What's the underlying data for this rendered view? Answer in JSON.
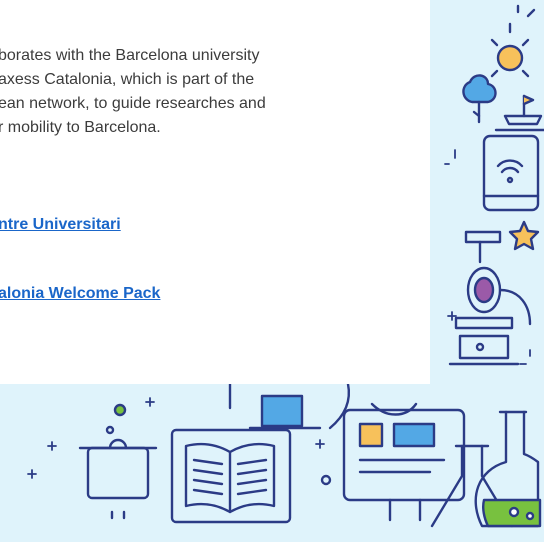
{
  "content": {
    "intro_lines": [
      "borates with the Barcelona university",
      "axess Catalonia, which is part of the",
      "ean network, to guide researches and",
      "r mobility to Barcelona."
    ],
    "links": [
      {
        "label": "ntre Universitari"
      },
      {
        "label": "alonia Welcome Pack"
      }
    ]
  },
  "colors": {
    "panel_background": "#dff3fb",
    "card_background": "#ffffff",
    "body_text": "#3c3c3c",
    "link": "#1a66c9",
    "line_art": "#2b3b86",
    "accent_orange": "#f7c15b",
    "accent_green": "#78c13f",
    "accent_blue": "#53a8e5",
    "accent_purple": "#9b5aa8"
  },
  "illustration": {
    "icons": [
      "sun-icon",
      "tree-icon",
      "boat-icon",
      "tablet-wifi-icon",
      "star-icon",
      "microscope-icon",
      "sparkle-icon",
      "lamp-icon",
      "book-icon",
      "cooking-pot-icon",
      "slide-presentation-icon",
      "flask-icon"
    ]
  }
}
